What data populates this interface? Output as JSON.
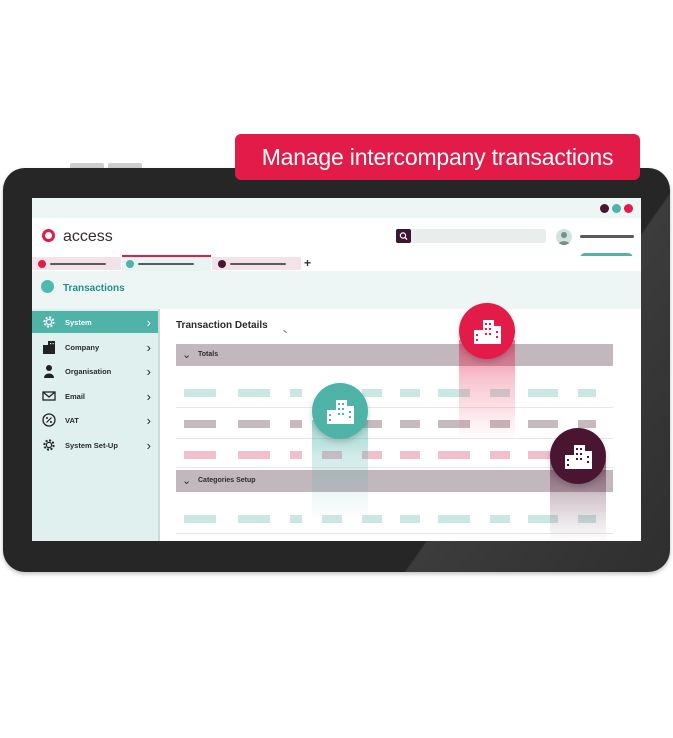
{
  "banner": {
    "text": "Manage intercompany transactions"
  },
  "app": {
    "logo_text": "access"
  },
  "page": {
    "title": "Transactions"
  },
  "colors": {
    "brand_red": "#e31b48",
    "teal": "#4fb3a8",
    "plum": "#4a1530"
  },
  "sidebar": {
    "items": [
      {
        "label": "System",
        "icon": "gear-icon",
        "active": true
      },
      {
        "label": "Company",
        "icon": "building-icon"
      },
      {
        "label": "Organisation",
        "icon": "person-icon"
      },
      {
        "label": "Email",
        "icon": "envelope-icon"
      },
      {
        "label": "VAT",
        "icon": "percent-icon"
      },
      {
        "label": "System Set-Up",
        "icon": "gear-icon"
      }
    ]
  },
  "main": {
    "title": "Transaction Details",
    "sections": [
      {
        "label": "Totals"
      },
      {
        "label": "Categories Setup"
      }
    ]
  },
  "tabs": {
    "add_label": "+"
  }
}
